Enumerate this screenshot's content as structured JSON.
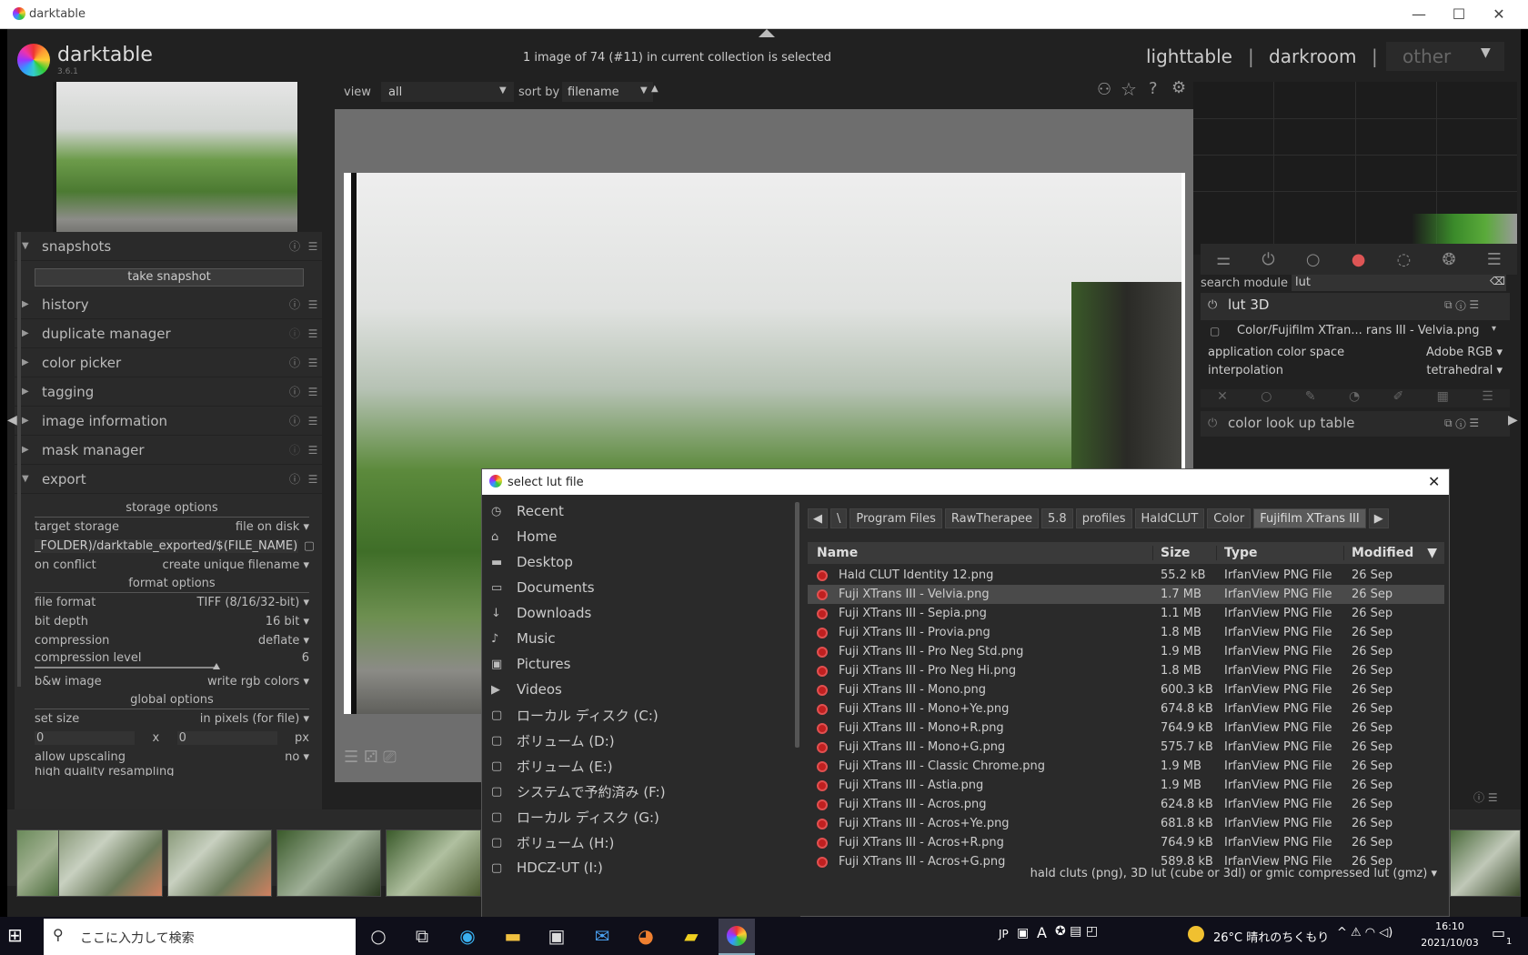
{
  "window": {
    "title": "darktable",
    "minimize": "—",
    "maximize": "☐",
    "close": "✕"
  },
  "header": {
    "app_name": "darktable",
    "version": "3.6.1",
    "selection_status": "1 image of 74 (#11) in current collection is selected",
    "views": [
      "lighttable",
      "darkroom",
      "other"
    ],
    "separator": "|"
  },
  "toolbar": {
    "view_label": "view",
    "view_value": "all",
    "sort_label": "sort by",
    "sort_value": "filename",
    "sort_dir": "▲"
  },
  "left_modules": {
    "snapshots": "snapshots",
    "take_snapshot": "take snapshot",
    "history": "history",
    "duplicate_manager": "duplicate manager",
    "color_picker": "color picker",
    "tagging": "tagging",
    "image_information": "image information",
    "mask_manager": "mask manager",
    "export": "export"
  },
  "export": {
    "storage_options": "storage options",
    "target_storage_label": "target storage",
    "target_storage_value": "file on disk",
    "path_value": "_FOLDER)/darktable_exported/$(FILE_NAME)",
    "on_conflict_label": "on conflict",
    "on_conflict_value": "create unique filename",
    "format_options": "format options",
    "file_format_label": "file format",
    "file_format_value": "TIFF (8/16/32-bit)",
    "bit_depth_label": "bit depth",
    "bit_depth_value": "16 bit",
    "compression_label": "compression",
    "compression_value": "deflate",
    "compression_level_label": "compression level",
    "compression_level_value": "6",
    "bw_label": "b&w image",
    "bw_value": "write rgb colors",
    "global_options": "global options",
    "set_size_label": "set size",
    "set_size_value": "in pixels (for file)",
    "width_value": "0",
    "x_label": "x",
    "height_value": "0",
    "px_label": "px",
    "upscaling_label": "allow upscaling",
    "upscaling_value": "no",
    "hq_label": "high quality resampling"
  },
  "right_panel": {
    "search_label": "search module",
    "search_value": "lut",
    "lut3d_title": "lut 3D",
    "lut_file": "Color/Fujifilm XTran... rans III - Velvia.png",
    "app_color_space_label": "application color space",
    "app_color_space_value": "Adobe RGB",
    "interpolation_label": "interpolation",
    "interpolation_value": "tetrahedral",
    "color_lut_title": "color look up table"
  },
  "dialog": {
    "title": "select lut file",
    "close": "✕",
    "places": [
      "Recent",
      "Home",
      "Desktop",
      "Documents",
      "Downloads",
      "Music",
      "Pictures",
      "Videos",
      "ローカル ディスク (C:)",
      "ボリューム (D:)",
      "ボリューム (E:)",
      "システムで予約済み (F:)",
      "ローカル ディスク (G:)",
      "ボリューム (H:)",
      "HDCZ-UT (I:)"
    ],
    "breadcrumbs": [
      "\\",
      "Program Files",
      "RawTherapee",
      "5.8",
      "profiles",
      "HaldCLUT",
      "Color",
      "Fujifilm XTrans III"
    ],
    "columns": {
      "name": "Name",
      "size": "Size",
      "type": "Type",
      "modified": "Modified"
    },
    "files": [
      {
        "name": "Hald CLUT Identity 12.png",
        "size": "55.2 kB",
        "type": "IrfanView PNG File",
        "modified": "26 Sep"
      },
      {
        "name": "Fuji XTrans III - Velvia.png",
        "size": "1.7 MB",
        "type": "IrfanView PNG File",
        "modified": "26 Sep"
      },
      {
        "name": "Fuji XTrans III - Sepia.png",
        "size": "1.1 MB",
        "type": "IrfanView PNG File",
        "modified": "26 Sep"
      },
      {
        "name": "Fuji XTrans III - Provia.png",
        "size": "1.8 MB",
        "type": "IrfanView PNG File",
        "modified": "26 Sep"
      },
      {
        "name": "Fuji XTrans III - Pro Neg Std.png",
        "size": "1.9 MB",
        "type": "IrfanView PNG File",
        "modified": "26 Sep"
      },
      {
        "name": "Fuji XTrans III - Pro Neg Hi.png",
        "size": "1.8 MB",
        "type": "IrfanView PNG File",
        "modified": "26 Sep"
      },
      {
        "name": "Fuji XTrans III - Mono.png",
        "size": "600.3 kB",
        "type": "IrfanView PNG File",
        "modified": "26 Sep"
      },
      {
        "name": "Fuji XTrans III - Mono+Ye.png",
        "size": "674.8 kB",
        "type": "IrfanView PNG File",
        "modified": "26 Sep"
      },
      {
        "name": "Fuji XTrans III - Mono+R.png",
        "size": "764.9 kB",
        "type": "IrfanView PNG File",
        "modified": "26 Sep"
      },
      {
        "name": "Fuji XTrans III - Mono+G.png",
        "size": "575.7 kB",
        "type": "IrfanView PNG File",
        "modified": "26 Sep"
      },
      {
        "name": "Fuji XTrans III - Classic Chrome.png",
        "size": "1.9 MB",
        "type": "IrfanView PNG File",
        "modified": "26 Sep"
      },
      {
        "name": "Fuji XTrans III - Astia.png",
        "size": "1.9 MB",
        "type": "IrfanView PNG File",
        "modified": "26 Sep"
      },
      {
        "name": "Fuji XTrans III - Acros.png",
        "size": "624.8 kB",
        "type": "IrfanView PNG File",
        "modified": "26 Sep"
      },
      {
        "name": "Fuji XTrans III - Acros+Ye.png",
        "size": "681.8 kB",
        "type": "IrfanView PNG File",
        "modified": "26 Sep"
      },
      {
        "name": "Fuji XTrans III - Acros+R.png",
        "size": "764.9 kB",
        "type": "IrfanView PNG File",
        "modified": "26 Sep"
      },
      {
        "name": "Fuji XTrans III - Acros+G.png",
        "size": "589.8 kB",
        "type": "IrfanView PNG File",
        "modified": "26 Sep"
      }
    ],
    "filter": "hald cluts (png), 3D lut (cube or 3dl) or gmic compressed lut (gmz)"
  },
  "taskbar": {
    "search_placeholder": "ここに入力して検索",
    "ime": "JP",
    "ime_mode": "A",
    "weather": "26°C 晴れのちくもり",
    "time": "16:10",
    "date": "2021/10/03",
    "notification_count": "1"
  }
}
